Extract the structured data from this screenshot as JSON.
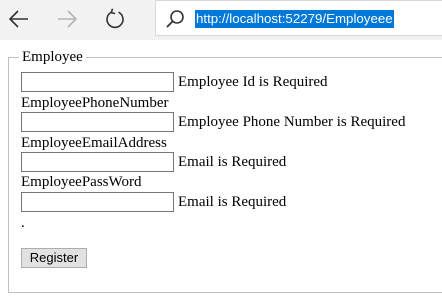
{
  "browser": {
    "url": "http://localhost:52279/Employeee",
    "back_icon": "arrow-left-icon",
    "forward_icon": "arrow-right-icon",
    "refresh_icon": "refresh-icon",
    "search_icon": "search-icon",
    "selection_color": "#0078d7"
  },
  "form": {
    "legend": "Employee",
    "fields": [
      {
        "label": "",
        "value": "",
        "error": "Employee Id is Required"
      },
      {
        "label": "EmployeePhoneNumber",
        "value": "",
        "error": "Employee Phone Number is Required"
      },
      {
        "label": "EmployeeEmailAddress",
        "value": "",
        "error": "Email is Required"
      },
      {
        "label": "EmployeePassWord",
        "value": "",
        "error": "Email is Required"
      }
    ],
    "trailing_text": ".",
    "submit_label": "Register"
  }
}
